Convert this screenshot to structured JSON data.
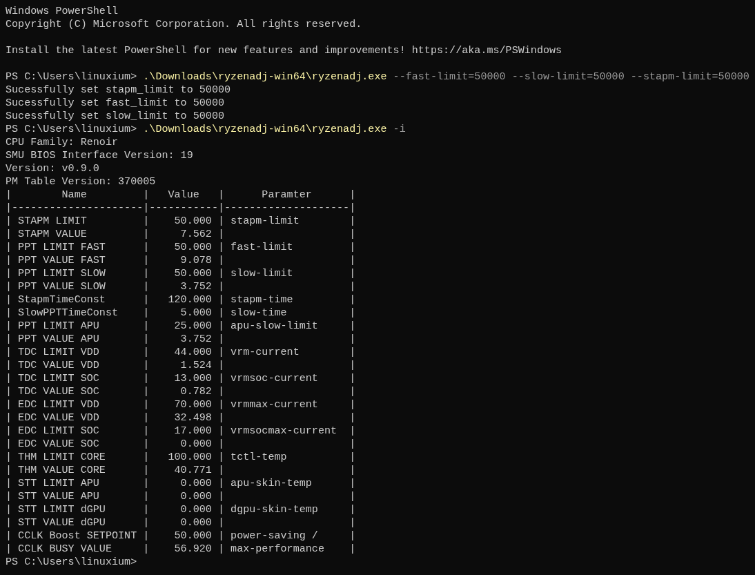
{
  "terminal": {
    "lines": [
      {
        "kind": "output",
        "text": "Windows PowerShell"
      },
      {
        "kind": "output",
        "text": "Copyright (C) Microsoft Corporation. All rights reserved."
      },
      {
        "kind": "blank"
      },
      {
        "kind": "output",
        "text": "Install the latest PowerShell for new features and improvements! https://aka.ms/PSWindows"
      },
      {
        "kind": "blank"
      },
      {
        "kind": "prompt",
        "prompt": "PS C:\\Users\\linuxium>",
        "command": ".\\Downloads\\ryzenadj-win64\\ryzenadj.exe",
        "args": "--fast-limit=50000 --slow-limit=50000 --stapm-limit=50000"
      },
      {
        "kind": "output",
        "text": "Sucessfully set stapm_limit to 50000"
      },
      {
        "kind": "output",
        "text": "Sucessfully set fast_limit to 50000"
      },
      {
        "kind": "output",
        "text": "Sucessfully set slow_limit to 50000"
      },
      {
        "kind": "prompt",
        "prompt": "PS C:\\Users\\linuxium>",
        "command": ".\\Downloads\\ryzenadj-win64\\ryzenadj.exe",
        "args": "-i"
      },
      {
        "kind": "output",
        "text": "CPU Family: Renoir"
      },
      {
        "kind": "output",
        "text": "SMU BIOS Interface Version: 19"
      },
      {
        "kind": "output",
        "text": "Version: v0.9.0"
      },
      {
        "kind": "output",
        "text": "PM Table Version: 370005"
      },
      {
        "kind": "output",
        "text": "|        Name         |   Value   |      Paramter      |"
      },
      {
        "kind": "output",
        "text": "|---------------------|-----------|--------------------|"
      },
      {
        "kind": "output",
        "text": "| STAPM LIMIT         |    50.000 | stapm-limit        |"
      },
      {
        "kind": "output",
        "text": "| STAPM VALUE         |     7.562 |                    |"
      },
      {
        "kind": "output",
        "text": "| PPT LIMIT FAST      |    50.000 | fast-limit         |"
      },
      {
        "kind": "output",
        "text": "| PPT VALUE FAST      |     9.078 |                    |"
      },
      {
        "kind": "output",
        "text": "| PPT LIMIT SLOW      |    50.000 | slow-limit         |"
      },
      {
        "kind": "output",
        "text": "| PPT VALUE SLOW      |     3.752 |                    |"
      },
      {
        "kind": "output",
        "text": "| StapmTimeConst      |   120.000 | stapm-time         |"
      },
      {
        "kind": "output",
        "text": "| SlowPPTTimeConst    |     5.000 | slow-time          |"
      },
      {
        "kind": "output",
        "text": "| PPT LIMIT APU       |    25.000 | apu-slow-limit     |"
      },
      {
        "kind": "output",
        "text": "| PPT VALUE APU       |     3.752 |                    |"
      },
      {
        "kind": "output",
        "text": "| TDC LIMIT VDD       |    44.000 | vrm-current        |"
      },
      {
        "kind": "output",
        "text": "| TDC VALUE VDD       |     1.524 |                    |"
      },
      {
        "kind": "output",
        "text": "| TDC LIMIT SOC       |    13.000 | vrmsoc-current     |"
      },
      {
        "kind": "output",
        "text": "| TDC VALUE SOC       |     0.782 |                    |"
      },
      {
        "kind": "output",
        "text": "| EDC LIMIT VDD       |    70.000 | vrmmax-current     |"
      },
      {
        "kind": "output",
        "text": "| EDC VALUE VDD       |    32.498 |                    |"
      },
      {
        "kind": "output",
        "text": "| EDC LIMIT SOC       |    17.000 | vrmsocmax-current  |"
      },
      {
        "kind": "output",
        "text": "| EDC VALUE SOC       |     0.000 |                    |"
      },
      {
        "kind": "output",
        "text": "| THM LIMIT CORE      |   100.000 | tctl-temp          |"
      },
      {
        "kind": "output",
        "text": "| THM VALUE CORE      |    40.771 |                    |"
      },
      {
        "kind": "output",
        "text": "| STT LIMIT APU       |     0.000 | apu-skin-temp      |"
      },
      {
        "kind": "output",
        "text": "| STT VALUE APU       |     0.000 |                    |"
      },
      {
        "kind": "output",
        "text": "| STT LIMIT dGPU      |     0.000 | dgpu-skin-temp     |"
      },
      {
        "kind": "output",
        "text": "| STT VALUE dGPU      |     0.000 |                    |"
      },
      {
        "kind": "output",
        "text": "| CCLK Boost SETPOINT |    50.000 | power-saving /     |"
      },
      {
        "kind": "output",
        "text": "| CCLK BUSY VALUE     |    56.920 | max-performance    |"
      },
      {
        "kind": "prompt",
        "prompt": "PS C:\\Users\\linuxium>"
      }
    ]
  }
}
